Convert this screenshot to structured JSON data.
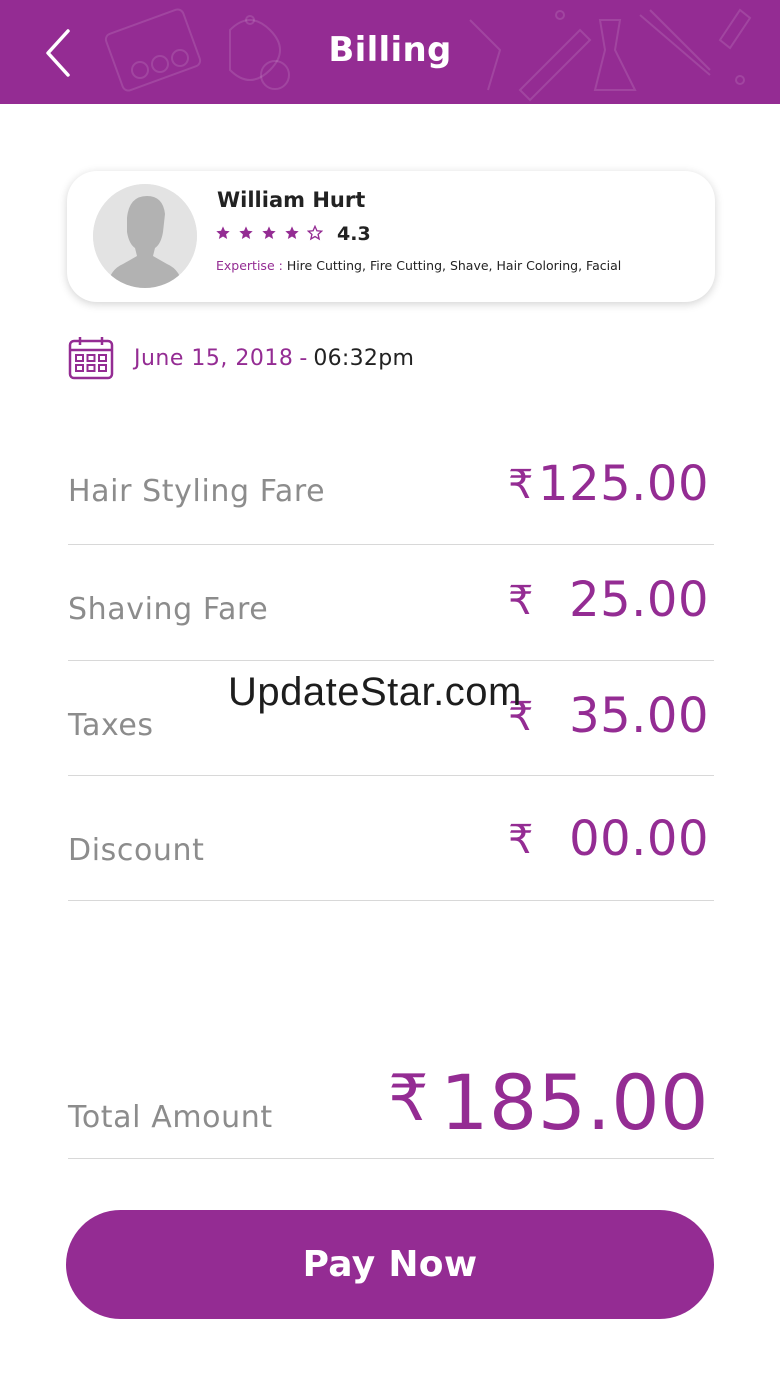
{
  "header": {
    "title": "Billing",
    "background_color": "#942c93",
    "back_icon": "chevron-left-icon"
  },
  "stylist": {
    "name": "William Hurt",
    "rating": "4.3",
    "stars_filled": 4,
    "stars_total": 5,
    "expertise_label": "Expertise :",
    "expertise_value": "Hire Cutting, Fire Cutting, Shave, Hair Coloring, Facial",
    "avatar_icon": "person-silhouette-icon"
  },
  "appointment": {
    "date": "June 15, 2018",
    "separator": "-",
    "time": "06:32pm",
    "calendar_icon": "calendar-icon"
  },
  "fares": [
    {
      "label": "Hair Styling Fare",
      "currency": "₹",
      "amount": "125.00"
    },
    {
      "label": "Shaving Fare",
      "currency": "₹",
      "amount": "25.00"
    },
    {
      "label": "Taxes",
      "currency": "₹",
      "amount": "35.00"
    },
    {
      "label": "Discount",
      "currency": "₹",
      "amount": "00.00"
    }
  ],
  "total": {
    "label": "Total Amount",
    "currency": "₹",
    "amount": "185.00"
  },
  "pay_button": {
    "label": "Pay Now"
  },
  "watermark": "UpdateStar.com",
  "colors": {
    "accent": "#942c93",
    "label_gray": "#8c8c8c",
    "divider": "#d8d8d8"
  }
}
